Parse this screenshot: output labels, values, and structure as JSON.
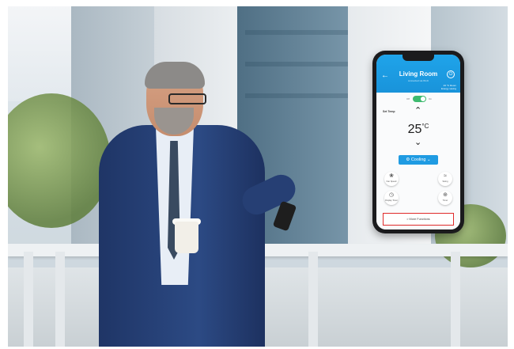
{
  "app": {
    "header": {
      "back_icon": "arrow-left-icon",
      "title": "Living Room",
      "subtitle": "connected via Wi-Fi",
      "power_icon": "power-icon",
      "status_line1": "23 °C Room",
      "status_line2": "Energy saving"
    },
    "power_toggle": {
      "off_label": "Off",
      "on_label": "On",
      "state": "on"
    },
    "set_temp_label": "Set Temp",
    "temperature": {
      "value": "25",
      "unit": "°C"
    },
    "mode": {
      "label": "Cooling",
      "icon": "gear-icon"
    },
    "functions": [
      {
        "label": "Fan Speed",
        "icon": "fan-icon"
      },
      {
        "label": "Swing",
        "icon": "swing-icon"
      },
      {
        "label": "Display Timer",
        "icon": "clock-icon"
      },
      {
        "label": "Timer",
        "icon": "timer-icon"
      }
    ],
    "more_functions": "> More Functions"
  },
  "colors": {
    "header_blue": "#1fa4ea",
    "toggle_green": "#3dba6f",
    "mode_blue": "#1f9be2",
    "highlight_red": "#e02a2a"
  }
}
